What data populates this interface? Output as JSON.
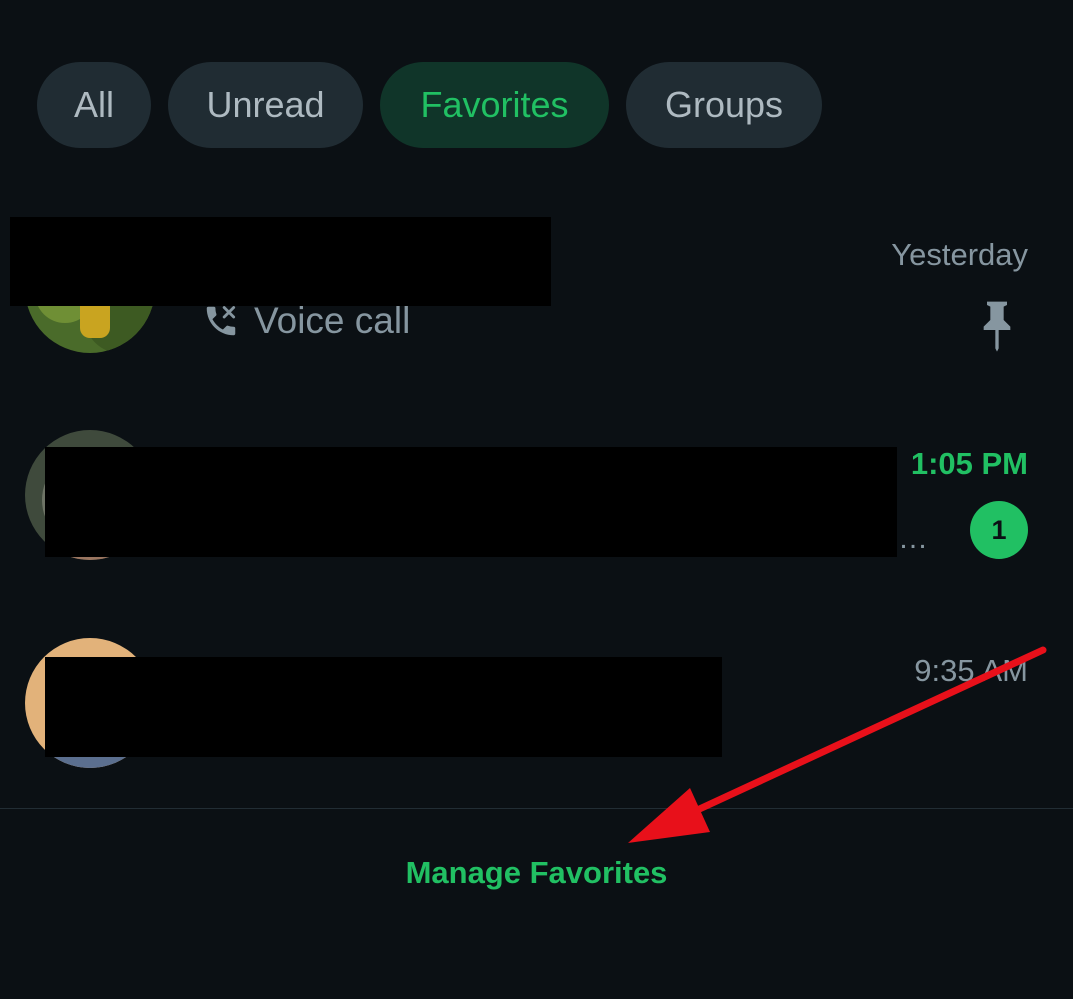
{
  "filters": [
    {
      "label": "All",
      "active": false
    },
    {
      "label": "Unread",
      "active": false
    },
    {
      "label": "Favorites",
      "active": true
    },
    {
      "label": "Groups",
      "active": false
    }
  ],
  "chats": [
    {
      "time": "Yesterday",
      "preview_icon": "voice-call-icon",
      "preview": "Voice call",
      "pinned": true,
      "pin_icon": "pin-icon"
    },
    {
      "time": "1:05 PM",
      "ellipsis": "…",
      "unread_count": "1"
    },
    {
      "time": "9:35 AM"
    }
  ],
  "footer": {
    "manage_label": "Manage Favorites"
  },
  "colors": {
    "background": "#0b1014",
    "accent": "#21c063",
    "chip": "#202c33",
    "chip_active": "#103529",
    "annotation_arrow": "#e8101a"
  }
}
